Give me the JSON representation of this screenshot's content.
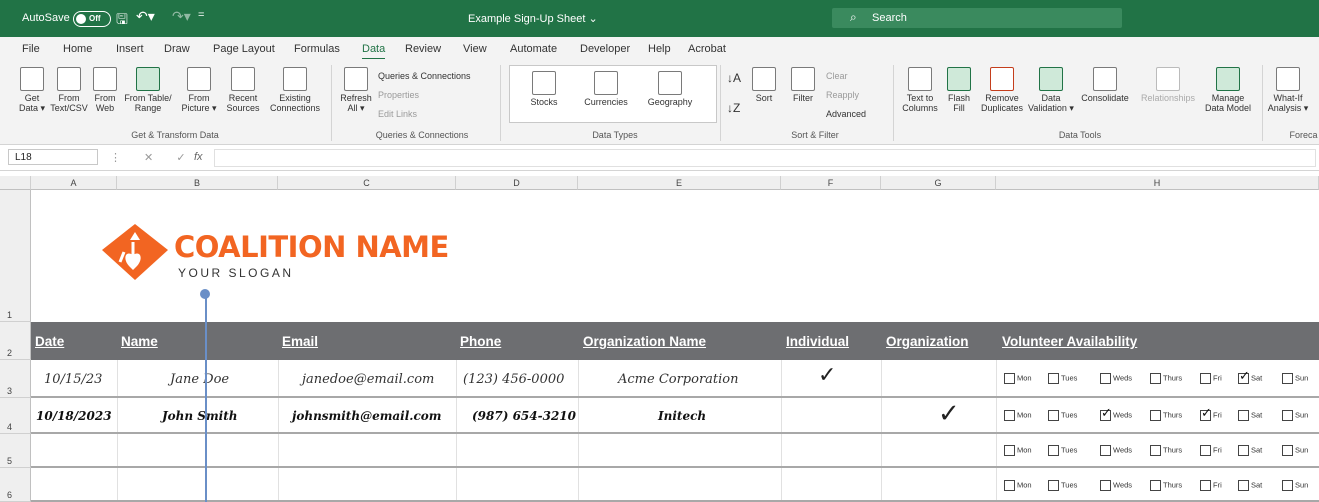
{
  "titlebar": {
    "autosave_label": "AutoSave",
    "autosave_state": "Off",
    "more_label": "=",
    "title": "Example Sign-Up Sheet ⌄",
    "search_placeholder": "Search"
  },
  "tabs": [
    "File",
    "Home",
    "Insert",
    "Draw",
    "Page Layout",
    "Formulas",
    "Data",
    "Review",
    "View",
    "Automate",
    "Developer",
    "Help",
    "Acrobat"
  ],
  "active_tab": "Data",
  "ribbon": {
    "get_data": [
      "Get",
      "Data ▾"
    ],
    "from_text": [
      "From",
      "Text/CSV"
    ],
    "from_web": [
      "From",
      "Web"
    ],
    "from_table": [
      "From Table/",
      "Range"
    ],
    "from_picture": [
      "From",
      "Picture ▾"
    ],
    "recent_sources": [
      "Recent",
      "Sources"
    ],
    "existing_connections": [
      "Existing",
      "Connections"
    ],
    "group_get_transform": "Get & Transform Data",
    "refresh_all": [
      "Refresh",
      "All ▾"
    ],
    "queries_connections": "Queries & Connections",
    "properties": "Properties",
    "edit_links": "Edit Links",
    "group_queries": "Queries & Connections",
    "stocks": "Stocks",
    "currencies": "Currencies",
    "geography": "Geography",
    "group_data_types": "Data Types",
    "sort": "Sort",
    "filter": "Filter",
    "clear": "Clear",
    "reapply": "Reapply",
    "advanced": "Advanced",
    "group_sort_filter": "Sort & Filter",
    "text_to_columns": [
      "Text to",
      "Columns"
    ],
    "flash_fill": [
      "Flash",
      "Fill"
    ],
    "remove_duplicates": [
      "Remove",
      "Duplicates"
    ],
    "data_validation": [
      "Data",
      "Validation ▾"
    ],
    "consolidate": "Consolidate",
    "relationships": "Relationships",
    "manage_data_model": [
      "Manage",
      "Data Model"
    ],
    "group_data_tools": "Data Tools",
    "what_if": [
      "What-If",
      "Analysis ▾"
    ],
    "group_forecast": "Foreca"
  },
  "formula_bar": {
    "name_box": "L18",
    "fx_label": "fx",
    "value": ""
  },
  "columns": [
    "A",
    "B",
    "C",
    "D",
    "E",
    "F",
    "G",
    "H"
  ],
  "rows": [
    "1",
    "2",
    "3",
    "4",
    "5",
    "6"
  ],
  "logo": {
    "title": "COALITION NAME",
    "slogan": "YOUR SLOGAN",
    "brand_color": "#f26522"
  },
  "table": {
    "header_bg": "#6d6e71",
    "headers": [
      "Date",
      "Name",
      "Email",
      "Phone",
      "Organization Name",
      "Individual",
      "Organization",
      "Volunteer Availability"
    ],
    "rows": [
      {
        "date": "10/15/23",
        "name": "Jane Doe",
        "email": "janedoe@email.com",
        "phone": "(123) 456-0000",
        "org_name": "Acme Corporation",
        "individual": true,
        "organization": false,
        "availability": {
          "Mon": false,
          "Tues": false,
          "Weds": false,
          "Thurs": false,
          "Fri": false,
          "Sat": true,
          "Sun": false
        }
      },
      {
        "date": "10/18/2023",
        "name": "John Smith",
        "email": "johnsmith@email.com",
        "phone": "(987) 654-3210",
        "org_name": "Initech",
        "individual": false,
        "organization": true,
        "availability": {
          "Mon": false,
          "Tues": false,
          "Weds": true,
          "Thurs": false,
          "Fri": true,
          "Sat": false,
          "Sun": false
        }
      },
      {
        "date": "",
        "name": "",
        "email": "",
        "phone": "",
        "org_name": "",
        "individual": false,
        "organization": false,
        "availability": {
          "Mon": false,
          "Tues": false,
          "Weds": false,
          "Thurs": false,
          "Fri": false,
          "Sat": false,
          "Sun": false
        }
      },
      {
        "date": "",
        "name": "",
        "email": "",
        "phone": "",
        "org_name": "",
        "individual": false,
        "organization": false,
        "availability": {
          "Mon": false,
          "Tues": false,
          "Weds": false,
          "Thurs": false,
          "Fri": false,
          "Sat": false,
          "Sun": false
        }
      }
    ],
    "days": [
      "Mon",
      "Tues",
      "Weds",
      "Thurs",
      "Fri",
      "Sat",
      "Sun"
    ],
    "check_glyph": "✓"
  }
}
